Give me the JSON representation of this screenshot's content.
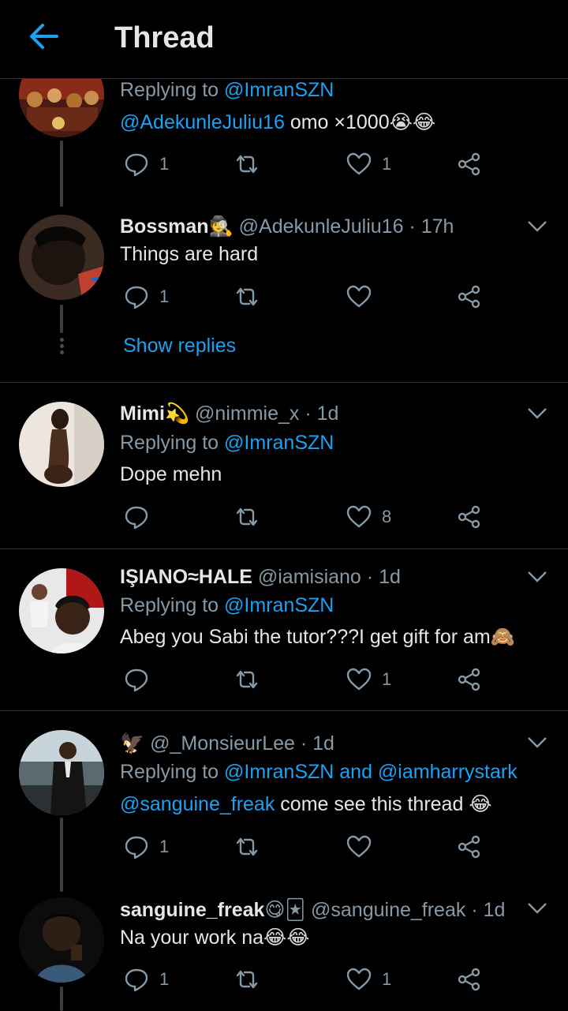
{
  "header": {
    "title": "Thread",
    "back_icon": "arrow-left-icon"
  },
  "colors": {
    "accent": "#1da1f2",
    "background": "#000000",
    "muted": "#8899a6",
    "text": "#e6e6e6"
  },
  "tweets": [
    {
      "replying_prefix": "Replying to",
      "replying_to": "@ImranSZN",
      "mention": "@AdekunleJuliu16",
      "body": "omo ×1000",
      "emojis": "😭😂",
      "replies": "1",
      "likes": "1"
    },
    {
      "name": "Bossman",
      "name_emoji": "🕵",
      "handle": "@AdekunleJuliu16",
      "time": "· 17h",
      "body": "Things are hard",
      "replies": "1",
      "show_replies": "Show replies"
    },
    {
      "name": "Mimi",
      "name_emoji": "💫",
      "handle": "@nimmie_x",
      "time": "· 1d",
      "replying_prefix": "Replying to",
      "replying_to": "@ImranSZN",
      "body": "Dope mehn",
      "likes": "8"
    },
    {
      "name": "IŞIANO≈HALE",
      "handle": "@iamisiano",
      "time": "· 1d",
      "replying_prefix": "Replying to",
      "replying_to": "@ImranSZN",
      "body": "Abeg you Sabi the tutor???I get gift for am",
      "emojis": "🙈",
      "likes": "1"
    },
    {
      "name_emoji": "🦅",
      "handle": "@_MonsieurLee",
      "time": "· 1d",
      "replying_prefix": "Replying to",
      "replying_to": "@ImranSZN and @iamharrystark",
      "mention": "@sanguine_freak",
      "body": "come see this thread",
      "emojis": "😂",
      "replies": "1"
    },
    {
      "name": "sanguine_freak",
      "name_emoji": "😋🃏",
      "handle": "@sanguine_freak",
      "time": "· 1d",
      "body": "Na your work na",
      "emojis": "😂😂",
      "replies": "1",
      "likes": "1"
    }
  ]
}
